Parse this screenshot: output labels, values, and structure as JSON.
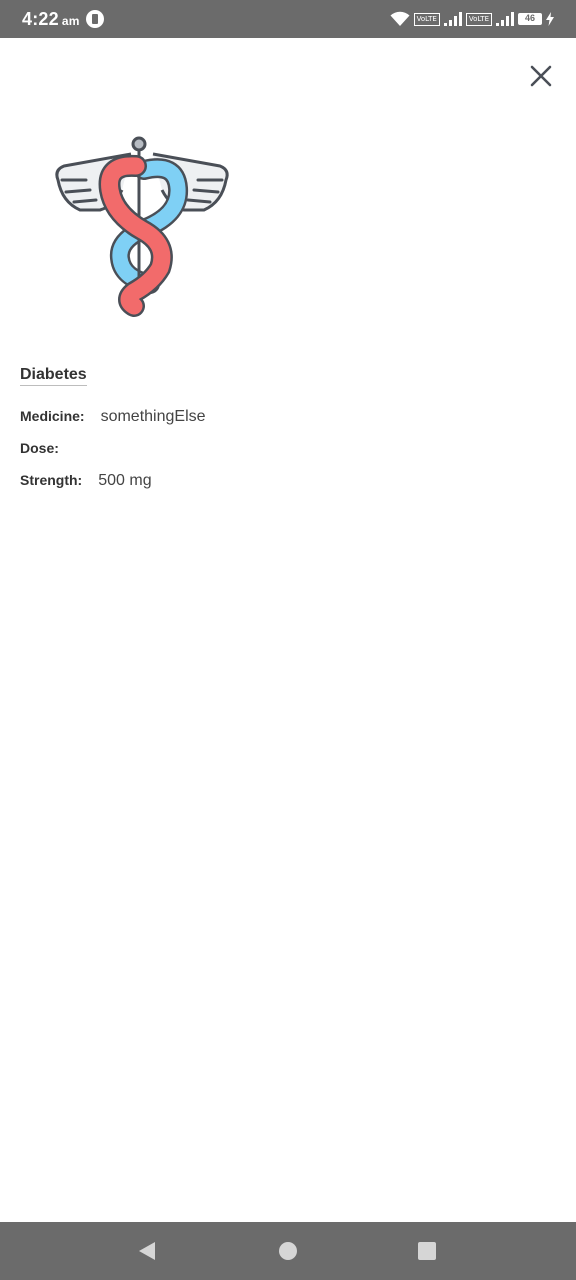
{
  "status_bar": {
    "time": "4:22",
    "ampm": "am",
    "volte_1": "VoLTE",
    "volte_2": "VoLTE",
    "battery": "46"
  },
  "icons": {
    "close": "close-icon",
    "logo": "caduceus-icon",
    "back": "back-icon",
    "home": "home-icon",
    "recent": "recent-apps-icon"
  },
  "detail": {
    "condition": "Diabetes",
    "medicine_label": "Medicine:",
    "medicine_value": "somethingElse",
    "dose_label": "Dose:",
    "dose_value": "",
    "strength_label": "Strength:",
    "strength_value": "500 mg"
  },
  "colors": {
    "status_bar": "#6b6b6b",
    "snake_red": "#f26b6b",
    "snake_blue": "#7fd0f5",
    "outline": "#4a4f57"
  }
}
